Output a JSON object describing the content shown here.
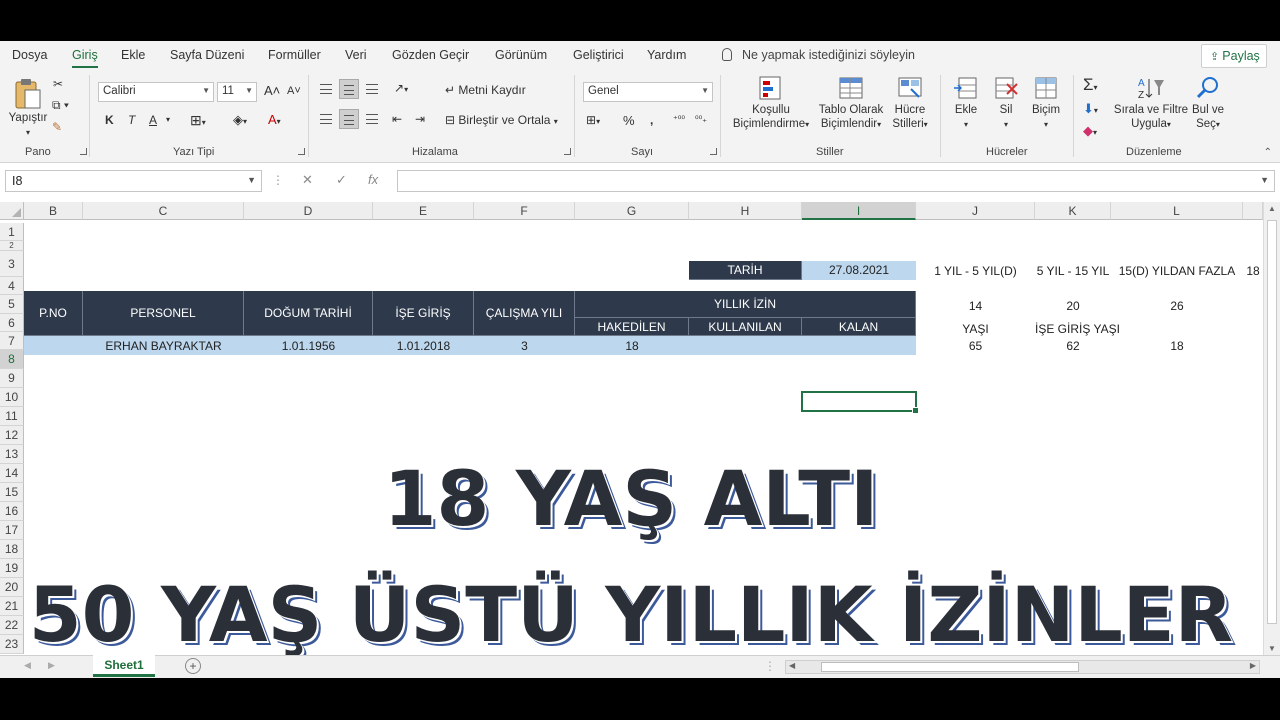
{
  "menu": {
    "tabs": [
      "Dosya",
      "Giriş",
      "Ekle",
      "Sayfa Düzeni",
      "Formüller",
      "Veri",
      "Gözden Geçir",
      "Görünüm",
      "Geliştirici",
      "Yardım"
    ],
    "tell_me": "Ne yapmak istediğinizi söyleyin",
    "share": "Paylaş"
  },
  "ribbon": {
    "clipboard": {
      "paste": "Yapıştır",
      "label": "Pano"
    },
    "font": {
      "name": "Calibri",
      "size": "11",
      "bold": "K",
      "italic": "T",
      "underline": "A",
      "label": "Yazı Tipi"
    },
    "alignment": {
      "wrap": "Metni Kaydır",
      "merge": "Birleştir ve Ortala",
      "label": "Hizalama"
    },
    "number": {
      "format": "Genel",
      "label": "Sayı"
    },
    "styles": {
      "conditional_1": "Koşullu",
      "conditional_2": "Biçimlendirme",
      "table_1": "Tablo Olarak",
      "table_2": "Biçimlendir",
      "cell_1": "Hücre",
      "cell_2": "Stilleri",
      "label": "Stiller"
    },
    "cells": {
      "insert": "Ekle",
      "delete": "Sil",
      "format": "Biçim",
      "label": "Hücreler"
    },
    "editing": {
      "sort_1": "Sırala ve Filtre",
      "sort_2": "Uygula",
      "find_1": "Bul ve",
      "find_2": "Seç",
      "label": "Düzenleme"
    }
  },
  "formula_bar": {
    "name_box": "I8",
    "formula": ""
  },
  "columns": [
    "B",
    "C",
    "D",
    "E",
    "F",
    "G",
    "H",
    "I",
    "J",
    "K",
    "L"
  ],
  "rows": [
    "1",
    "2",
    "3",
    "4",
    "5",
    "6",
    "7",
    "8",
    "9",
    "10",
    "11",
    "12",
    "13",
    "14",
    "15",
    "16",
    "17",
    "18",
    "19",
    "20",
    "21",
    "22",
    "23"
  ],
  "sheet": {
    "tarih_label": "TARİH",
    "tarih_value": "27.08.2021",
    "headers": {
      "pno": "P.NO",
      "personel": "PERSONEL",
      "dogum": "DOĞUM TARİHİ",
      "ise_giris": "İŞE GİRİŞ",
      "calisma": "ÇALIŞMA YILI",
      "yillik_izin": "YILLIK İZİN",
      "hakedilen": "HAKEDİLEN",
      "kullanilan": "KULLANILAN",
      "kalan": "KALAN"
    },
    "row5": {
      "personel": "ERHAN BAYRAKTAR",
      "dogum": "1.01.1956",
      "ise_giris": "1.01.2018",
      "calisma": "3",
      "hakedilen": "18"
    },
    "side": {
      "j1": "1 YIL - 5 YIL(D)",
      "k1": "5 YIL - 15 YIL",
      "l1": "15(D) YILDAN FAZLA",
      "m1": "18",
      "j3": "14",
      "k3": "20",
      "l3": "26",
      "j4": "YAŞI",
      "k4": "İŞE GİRİŞ YAŞI",
      "j5": "65",
      "k5": "62",
      "l5": "18"
    }
  },
  "overlay": {
    "line1": "18 YAŞ ALTI",
    "line2": "50 YAŞ ÜSTÜ YILLIK İZİNLER"
  },
  "sheet_tab": "Sheet1"
}
